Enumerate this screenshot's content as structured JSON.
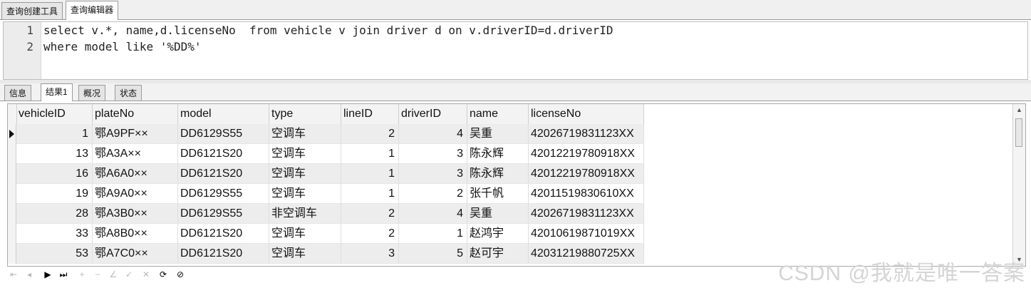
{
  "top_tabs": [
    {
      "label": "查询创建工具",
      "active": false
    },
    {
      "label": "查询编辑器",
      "active": true
    }
  ],
  "editor": {
    "line_numbers": [
      "1",
      "2"
    ],
    "lines": [
      "select v.*, name,d.licenseNo  from vehicle v join driver d on v.driverID=d.driverID",
      "where model like '%DD%'"
    ]
  },
  "result_tabs": [
    {
      "label": "信息",
      "active": false
    },
    {
      "label": "结果1",
      "active": true
    },
    {
      "label": "概况",
      "active": false
    },
    {
      "label": "状态",
      "active": false
    }
  ],
  "grid": {
    "columns": [
      "vehicleID",
      "plateNo",
      "model",
      "type",
      "lineID",
      "driverID",
      "name",
      "licenseNo"
    ],
    "rows": [
      [
        "1",
        "鄂A9PF××",
        "DD6129S55",
        "空调车",
        "2",
        "4",
        "吴重",
        "42026719831123XX"
      ],
      [
        "13",
        "鄂A3A××",
        "DD6121S20",
        "空调车",
        "1",
        "3",
        "陈永辉",
        "42012219780918XX"
      ],
      [
        "16",
        "鄂A6A0××",
        "DD6121S20",
        "空调车",
        "1",
        "3",
        "陈永辉",
        "42012219780918XX"
      ],
      [
        "19",
        "鄂A9A0××",
        "DD6129S55",
        "空调车",
        "1",
        "2",
        "张千帆",
        "42011519830610XX"
      ],
      [
        "28",
        "鄂A3B0××",
        "DD6129S55",
        "非空调车",
        "2",
        "4",
        "吴重",
        "42026719831123XX"
      ],
      [
        "33",
        "鄂A8B0××",
        "DD6121S20",
        "空调车",
        "2",
        "1",
        "赵鸿宇",
        "42010619871019XX"
      ],
      [
        "53",
        "鄂A7C0××",
        "DD6121S20",
        "空调车",
        "3",
        "5",
        "赵可宇",
        "42031219880725XX"
      ]
    ],
    "current_row": 0
  },
  "nav_buttons": [
    {
      "icon": "first-record-icon",
      "glyph": "⇤",
      "enabled": false
    },
    {
      "icon": "prior-record-icon",
      "glyph": "◂",
      "enabled": false
    },
    {
      "icon": "next-record-icon",
      "glyph": "▶",
      "enabled": true
    },
    {
      "icon": "last-record-icon",
      "glyph": "⏭",
      "enabled": true
    },
    {
      "icon": "insert-record-icon",
      "glyph": "+",
      "enabled": false
    },
    {
      "icon": "delete-record-icon",
      "glyph": "−",
      "enabled": false
    },
    {
      "icon": "edit-record-icon",
      "glyph": "∠",
      "enabled": false
    },
    {
      "icon": "post-edit-icon",
      "glyph": "✓",
      "enabled": false
    },
    {
      "icon": "cancel-edit-icon",
      "glyph": "✕",
      "enabled": false
    },
    {
      "icon": "refresh-icon",
      "glyph": "⟳",
      "enabled": true
    },
    {
      "icon": "stop-icon",
      "glyph": "⊘",
      "enabled": true
    }
  ],
  "watermark": "CSDN @我就是唯一答案"
}
